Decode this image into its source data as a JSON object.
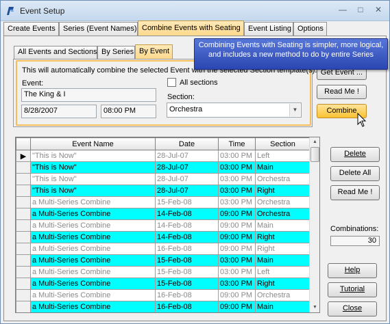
{
  "window": {
    "title": "Event Setup"
  },
  "tabs": [
    {
      "label": "Create Events",
      "active": false
    },
    {
      "label": "Series (Event Names)",
      "active": false
    },
    {
      "label": "Combine Events with Seating",
      "active": true
    },
    {
      "label": "Event Listing",
      "active": false
    },
    {
      "label": "Options",
      "active": false
    }
  ],
  "subtabs": [
    {
      "label": "All Events and Sections",
      "active": false
    },
    {
      "label": "By Series",
      "active": false
    },
    {
      "label": "By Event",
      "active": true
    }
  ],
  "tooltip": {
    "text": "Combining Events with Seating is simpler, more logical, and includes a new method to do by entire Series"
  },
  "panel": {
    "instructions": "This will automatically combine the selected Event with the selected Section template(s).",
    "event_label": "Event:",
    "event_value": "The King & I",
    "date_value": "8/28/2007",
    "time_value": "08:00 PM",
    "all_sections_label": "All sections",
    "section_label": "Section:",
    "section_value": "Orchestra",
    "get_event_label": "Get Event ...",
    "read_me_label": "Read Me !",
    "combine_label": "Combine"
  },
  "grid": {
    "columns": [
      "Event Name",
      "Date",
      "Time",
      "Section"
    ],
    "rows": [
      {
        "event": "\"This is Now\"",
        "date": "28-Jul-07",
        "time": "03:00 PM",
        "section": "Left",
        "highlighted": false,
        "current": true
      },
      {
        "event": "\"This is Now\"",
        "date": "28-Jul-07",
        "time": "03:00 PM",
        "section": "Main",
        "highlighted": true,
        "current": false
      },
      {
        "event": "\"This is Now\"",
        "date": "28-Jul-07",
        "time": "03:00 PM",
        "section": "Orchestra",
        "highlighted": false,
        "current": false
      },
      {
        "event": "\"This is Now\"",
        "date": "28-Jul-07",
        "time": "03:00 PM",
        "section": "Right",
        "highlighted": true,
        "current": false
      },
      {
        "event": "a Multi-Series Combine",
        "date": "15-Feb-08",
        "time": "03:00 PM",
        "section": "Orchestra",
        "highlighted": false,
        "current": false
      },
      {
        "event": "a Multi-Series Combine",
        "date": "14-Feb-08",
        "time": "09:00 PM",
        "section": "Orchestra",
        "highlighted": true,
        "current": false
      },
      {
        "event": "a Multi-Series Combine",
        "date": "14-Feb-08",
        "time": "09:00 PM",
        "section": "Main",
        "highlighted": false,
        "current": false
      },
      {
        "event": "a Multi-Series Combine",
        "date": "14-Feb-08",
        "time": "09:00 PM",
        "section": "Right",
        "highlighted": true,
        "current": false
      },
      {
        "event": "a Multi-Series Combine",
        "date": "16-Feb-08",
        "time": "09:00 PM",
        "section": "Right",
        "highlighted": false,
        "current": false
      },
      {
        "event": "a Multi-Series Combine",
        "date": "15-Feb-08",
        "time": "03:00 PM",
        "section": "Main",
        "highlighted": true,
        "current": false
      },
      {
        "event": "a Multi-Series Combine",
        "date": "15-Feb-08",
        "time": "03:00 PM",
        "section": "Left",
        "highlighted": false,
        "current": false
      },
      {
        "event": "a Multi-Series Combine",
        "date": "15-Feb-08",
        "time": "03:00 PM",
        "section": "Right",
        "highlighted": true,
        "current": false
      },
      {
        "event": "a Multi-Series Combine",
        "date": "16-Feb-08",
        "time": "09:00 PM",
        "section": "Orchestra",
        "highlighted": false,
        "current": false
      },
      {
        "event": "a Multi-Series Combine",
        "date": "16-Feb-08",
        "time": "09:00 PM",
        "section": "Main",
        "highlighted": true,
        "current": false
      }
    ]
  },
  "side_buttons": {
    "delete": "Delete",
    "delete_all": "Delete All",
    "read_me": "Read Me !",
    "help": "Help",
    "tutorial": "Tutorial",
    "close": "Close"
  },
  "combinations": {
    "label": "Combinations:",
    "value": "30"
  },
  "colors": {
    "highlight": "#00ffff",
    "active_tab": "#fcd98c",
    "tooltip": "#3c58c4"
  }
}
